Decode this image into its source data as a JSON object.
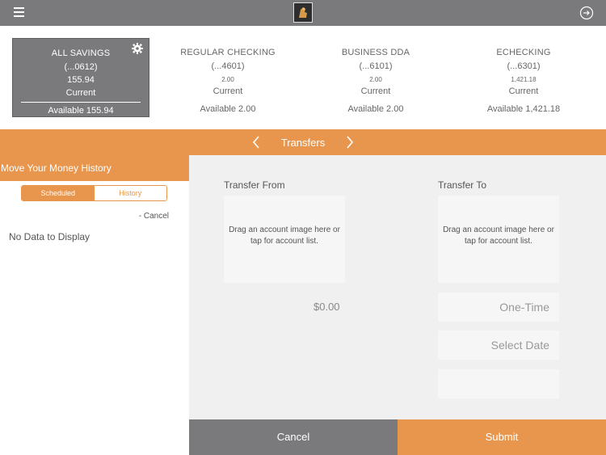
{
  "header": {
    "menu_icon": "hamburger-icon",
    "logo_icon": "bank-logo-icon",
    "logout_icon": "logout-icon"
  },
  "accounts": [
    {
      "name": "ALL SAVINGS",
      "number": "(...0612)",
      "balance": "155.94",
      "status": "Current",
      "available": "Available 155.94"
    },
    {
      "name": "REGULAR CHECKING",
      "number": "(...4601)",
      "balance": "2.00",
      "status": "Current",
      "available": "Available 2.00"
    },
    {
      "name": "BUSINESS DDA",
      "number": "(...6101)",
      "balance": "2.00",
      "status": "Current",
      "available": "Available 2.00"
    },
    {
      "name": "ECHECKING",
      "number": "(...6301)",
      "balance": "1,421.18",
      "status": "Current",
      "available": "Available 1,421.18"
    }
  ],
  "titlebar": {
    "title": "Transfers"
  },
  "history": {
    "header": "Move Your Money History",
    "tab_scheduled": "Scheduled",
    "tab_history": "History",
    "cancel_link": "- Cancel",
    "empty": "No Data to Display"
  },
  "transfer": {
    "from_label": "Transfer From",
    "to_label": "Transfer To",
    "from_placeholder": "Drag an account image here or tap for account list.",
    "to_placeholder": "Drag an account image here or tap for account list.",
    "amount": "$0.00",
    "frequency": "One-Time",
    "date": "Select Date"
  },
  "buttons": {
    "cancel": "Cancel",
    "submit": "Submit"
  },
  "colors": {
    "accent": "#e8964d",
    "gray": "#7a7a7c"
  }
}
